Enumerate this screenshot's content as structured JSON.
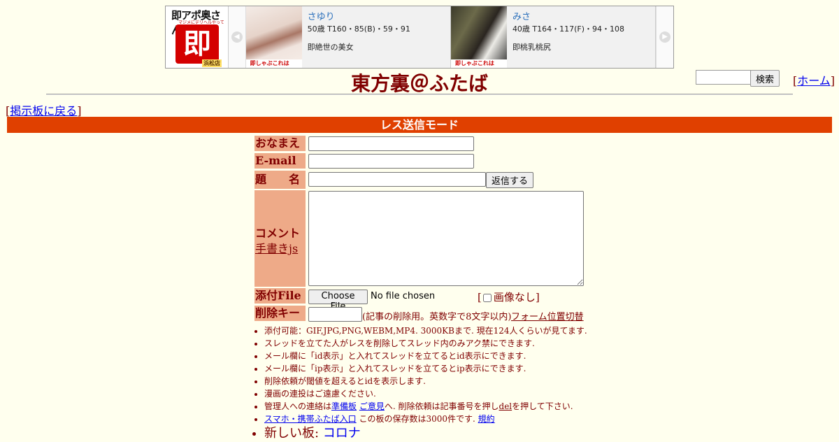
{
  "ad": {
    "logo": {
      "top": "即アポ奥さん",
      "sub": "マジメにデリヘルやってます",
      "mark": "即",
      "store": "浜松店"
    },
    "prev_arrow": "◀",
    "next_arrow": "▶",
    "cards": [
      {
        "name": "さゆり",
        "spec": "50歳 T160・85(B)・59・91",
        "catch": "即絶世の美女",
        "ribbon": "即しゃぶこれは"
      },
      {
        "name": "みさ",
        "spec": "40歳 T164・117(F)・94・108",
        "catch": "即桃乳桃尻",
        "ribbon": "即しゃぶこれは"
      }
    ]
  },
  "header": {
    "title": "東方裏＠ふたば",
    "search_button": "検索",
    "home_link": "ホーム",
    "back_link": "掲示板に戻る"
  },
  "mode_bar": "レス送信モード",
  "form": {
    "name_label": "おなまえ",
    "email_label": "E-mail",
    "subject_label": "題　　名",
    "submit_button": "返信する",
    "comment_label": "コメント",
    "handwriting_link": "手書きjs",
    "file_label": "添付File",
    "file_button": "Choose File",
    "file_status": "No file chosen",
    "no_image_label": "画像なし",
    "delkey_label": "削除キー",
    "delkey_note": "(記事の削除用。英数字で8文字以内)",
    "form_switch_link": "フォーム位置切替"
  },
  "notes": {
    "n1": "添付可能：GIF,JPG,PNG,WEBM,MP4. 3000KBまで. 現在124人くらいが見てます.",
    "n2": "スレッドを立てた人がレスを削除してスレッド内のみアク禁にできます.",
    "n3": "メール欄に「id表示」と入れてスレッドを立てるとid表示にできます.",
    "n4": "メール欄に「ip表示」と入れてスレッドを立てるとip表示にできます.",
    "n5": "削除依頼が閾値を超えるとidを表示します.",
    "n6": "漫画の連投はご遠慮ください.",
    "n7_pre": "管理人への連絡は",
    "n7_link1": "準備板",
    "n7_link2": "ご意見",
    "n7_mid": "へ. 削除依頼は記事番号を押し",
    "n7_link3": "del",
    "n7_post": "を押して下さい.",
    "n8_link1": "スマホ・携帯ふたば入口",
    "n8_mid": "この板の保存数は3000件です.",
    "n8_link2": "規約",
    "n9_label": "新しい板: ",
    "n9_link": "コロナ"
  }
}
